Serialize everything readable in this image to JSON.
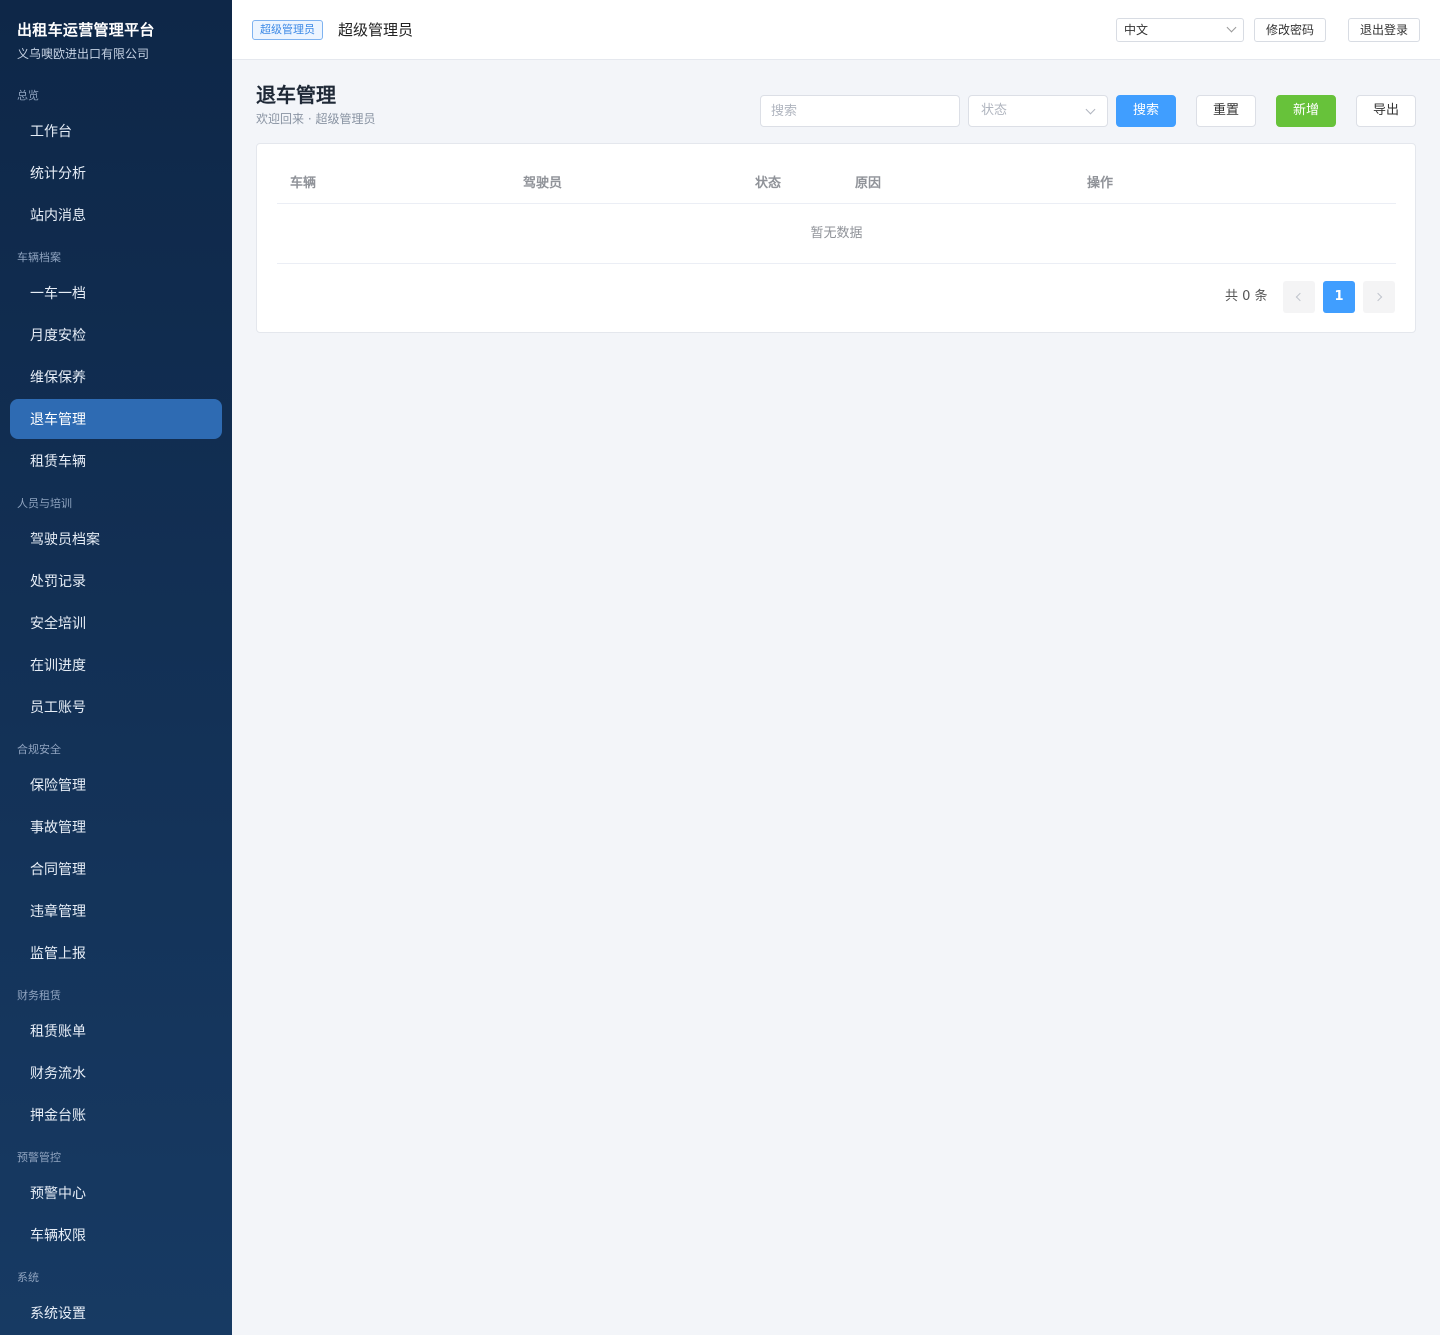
{
  "sidebar": {
    "brand_title": "出租车运营管理平台",
    "brand_sub": "义乌噢欧进出口有限公司",
    "groups": [
      {
        "label": "总览",
        "items": [
          "工作台",
          "统计分析",
          "站内消息"
        ]
      },
      {
        "label": "车辆档案",
        "items": [
          "一车一档",
          "月度安检",
          "维保保养",
          "退车管理",
          "租赁车辆"
        ]
      },
      {
        "label": "人员与培训",
        "items": [
          "驾驶员档案",
          "处罚记录",
          "安全培训",
          "在训进度",
          "员工账号"
        ]
      },
      {
        "label": "合规安全",
        "items": [
          "保险管理",
          "事故管理",
          "合同管理",
          "违章管理",
          "监管上报"
        ]
      },
      {
        "label": "财务租赁",
        "items": [
          "租赁账单",
          "财务流水",
          "押金台账"
        ]
      },
      {
        "label": "预警管控",
        "items": [
          "预警中心",
          "车辆权限"
        ]
      },
      {
        "label": "系统",
        "items": [
          "系统设置"
        ]
      }
    ],
    "active_item": "退车管理"
  },
  "topbar": {
    "role_tag": "超级管理员",
    "user_name": "超级管理员",
    "language": "中文",
    "change_password": "修改密码",
    "logout": "退出登录"
  },
  "page": {
    "title": "退车管理",
    "subtitle": "欢迎回来 · 超级管理员",
    "search_placeholder": "搜索",
    "status_placeholder": "状态",
    "search_button": "搜索",
    "reset_button": "重置",
    "add_button": "新增",
    "export_button": "导出"
  },
  "table": {
    "columns": [
      "车辆",
      "驾驶员",
      "状态",
      "原因",
      "操作"
    ],
    "rows": [],
    "empty_text": "暂无数据"
  },
  "pagination": {
    "total_text": "共 0 条",
    "current_page": "1"
  },
  "colors": {
    "sidebar_top": "#0e2748",
    "sidebar_active": "#2e6bb3",
    "primary": "#409eff",
    "success": "#67c23a"
  }
}
